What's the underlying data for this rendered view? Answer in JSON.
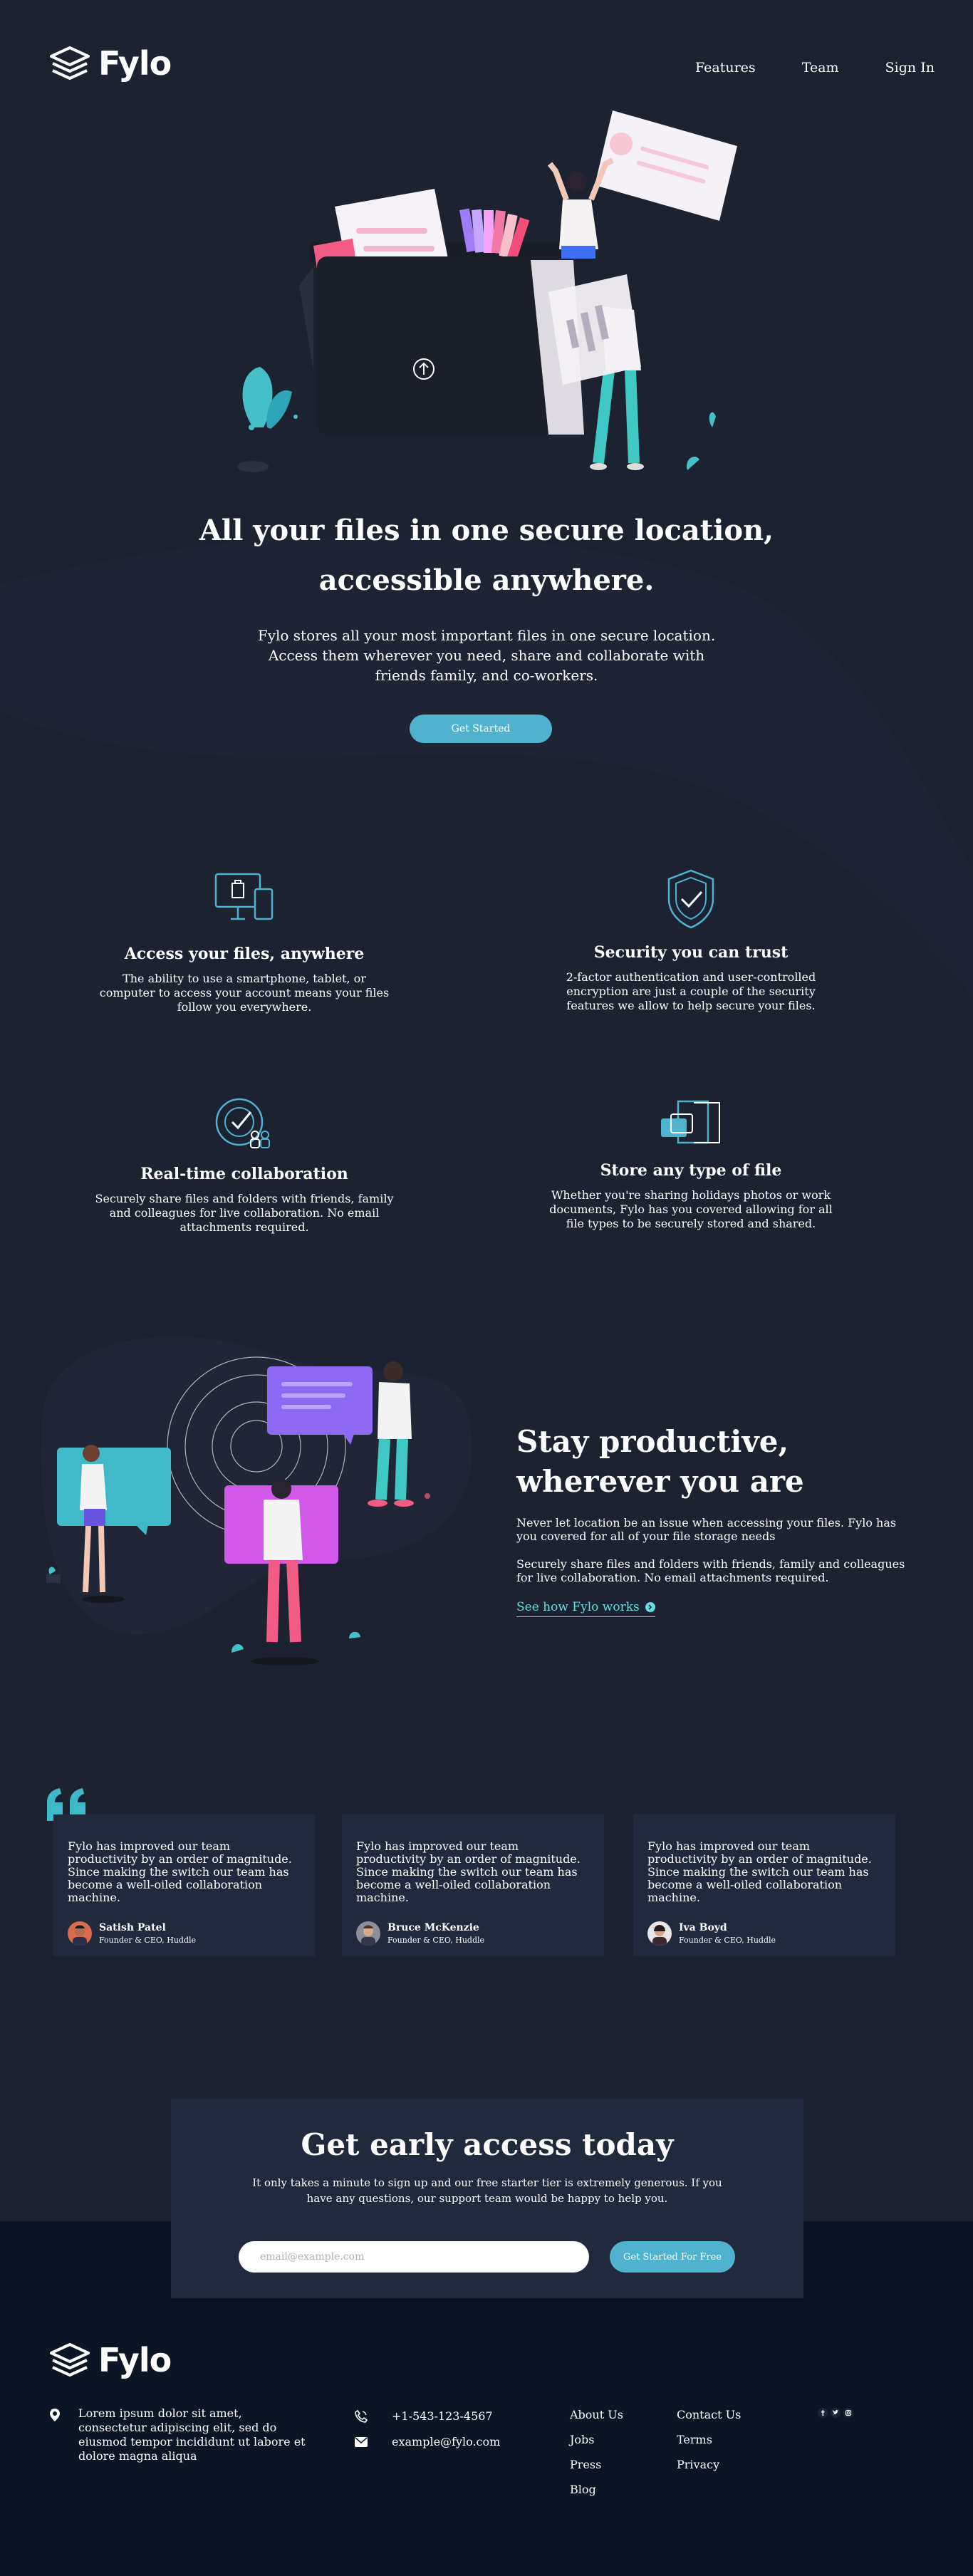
{
  "brand": {
    "name": "Fylo"
  },
  "nav": {
    "features": "Features",
    "team": "Team",
    "signin": "Sign In"
  },
  "hero": {
    "title_line1": "All your files in one secure location,",
    "title_line2": "accessible anywhere.",
    "text_line1": "Fylo stores all your most important files in one secure location.",
    "text_line2": "Access them wherever you need, share and collaborate with",
    "text_line3": "friends family, and co-workers.",
    "cta": "Get Started"
  },
  "features": [
    {
      "title": "Access your files, anywhere",
      "text": "The ability to use a smartphone, tablet, or computer to access your account means your files follow you everywhere.",
      "icon": "devices-icon"
    },
    {
      "title": "Security you can trust",
      "text": "2-factor authentication and user-controlled encryption are just a couple of the security features we allow to help secure your files.",
      "icon": "shield-icon"
    },
    {
      "title": "Real-time collaboration",
      "text": "Securely share files and folders with friends, family and colleagues for live collaboration. No email attachments required.",
      "icon": "collaboration-icon"
    },
    {
      "title": "Store any type of file",
      "text": "Whether you're sharing holidays photos or work documents, Fylo has you covered allowing for all file types to be securely stored and shared.",
      "icon": "files-icon"
    }
  ],
  "productive": {
    "title_line1": "Stay productive,",
    "title_line2": "wherever you are",
    "p1": "Never let location be an issue when accessing your files. Fylo has you covered for all of your file storage needs",
    "p2": "Securely share files and folders with friends, family and colleagues for live collaboration. No email attachments required.",
    "link": "See how Fylo works"
  },
  "testimonials": [
    {
      "quote": "Fylo has improved our team productivity by an order of magnitude. Since making the switch our team has become a well-oiled collaboration machine.",
      "name": "Satish Patel",
      "role": "Founder & CEO, Huddle"
    },
    {
      "quote": "Fylo has improved our team productivity by an order of magnitude. Since making the switch our team has become a well-oiled collaboration machine.",
      "name": "Bruce McKenzie",
      "role": "Founder & CEO, Huddle"
    },
    {
      "quote": "Fylo has improved our team productivity by an order of magnitude. Since making the switch our team has become a well-oiled collaboration machine.",
      "name": "Iva Boyd",
      "role": "Founder & CEO, Huddle"
    }
  ],
  "cta": {
    "title": "Get early access today",
    "text": "It only takes a minute to sign up and our free starter tier is extremely generous. If you have any questions, our support team would be happy to help you.",
    "placeholder": "email@example.com",
    "button": "Get Started For Free"
  },
  "footer": {
    "address": "Lorem ipsum dolor sit amet, consectetur adipiscing elit, sed do eiusmod tempor incididunt ut labore et dolore magna aliqua",
    "phone": "+1-543-123-4567",
    "email": "example@fylo.com",
    "col1": [
      "About Us",
      "Jobs",
      "Press",
      "Blog"
    ],
    "col2": [
      "Contact Us",
      "Terms",
      "Privacy"
    ],
    "social": [
      "facebook-icon",
      "twitter-icon",
      "instagram-icon"
    ]
  },
  "colors": {
    "bg": "#1c2230",
    "card": "#212a3d",
    "footer": "#0c1524",
    "accent": "#4fb3cf",
    "link": "#62e0d9"
  }
}
